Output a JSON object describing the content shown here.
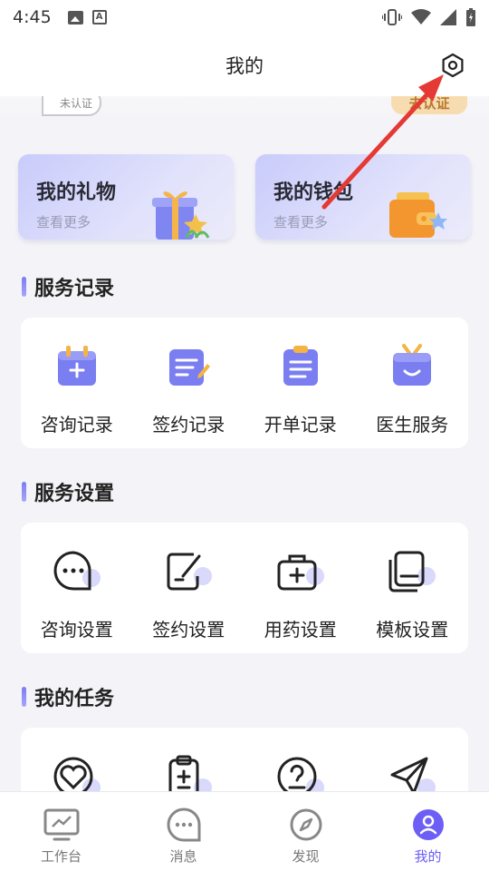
{
  "status_bar": {
    "time": "4:45"
  },
  "header": {
    "title": "我的"
  },
  "profile": {
    "verify_badge": "未认证",
    "verify_button": "去认证"
  },
  "cards": [
    {
      "title": "我的礼物",
      "subtitle": "查看更多"
    },
    {
      "title": "我的钱包",
      "subtitle": "查看更多"
    }
  ],
  "sections": {
    "records": {
      "title": "服务记录",
      "items": [
        "咨询记录",
        "签约记录",
        "开单记录",
        "医生服务"
      ]
    },
    "settings": {
      "title": "服务设置",
      "items": [
        "咨询设置",
        "签约设置",
        "用药设置",
        "模板设置"
      ]
    },
    "tasks": {
      "title": "我的任务"
    }
  },
  "tabbar": {
    "items": [
      {
        "label": "工作台",
        "icon": "monitor-chart-icon"
      },
      {
        "label": "消息",
        "icon": "chat-bubble-icon"
      },
      {
        "label": "发现",
        "icon": "compass-icon"
      },
      {
        "label": "我的",
        "icon": "user-icon"
      }
    ],
    "active_index": 3
  },
  "colors": {
    "accent": "#6d5ef5",
    "annotation_arrow": "#e53935",
    "card_gradient_start": "#c9cbfb",
    "verify_button_bg": "#f7dcb2"
  }
}
